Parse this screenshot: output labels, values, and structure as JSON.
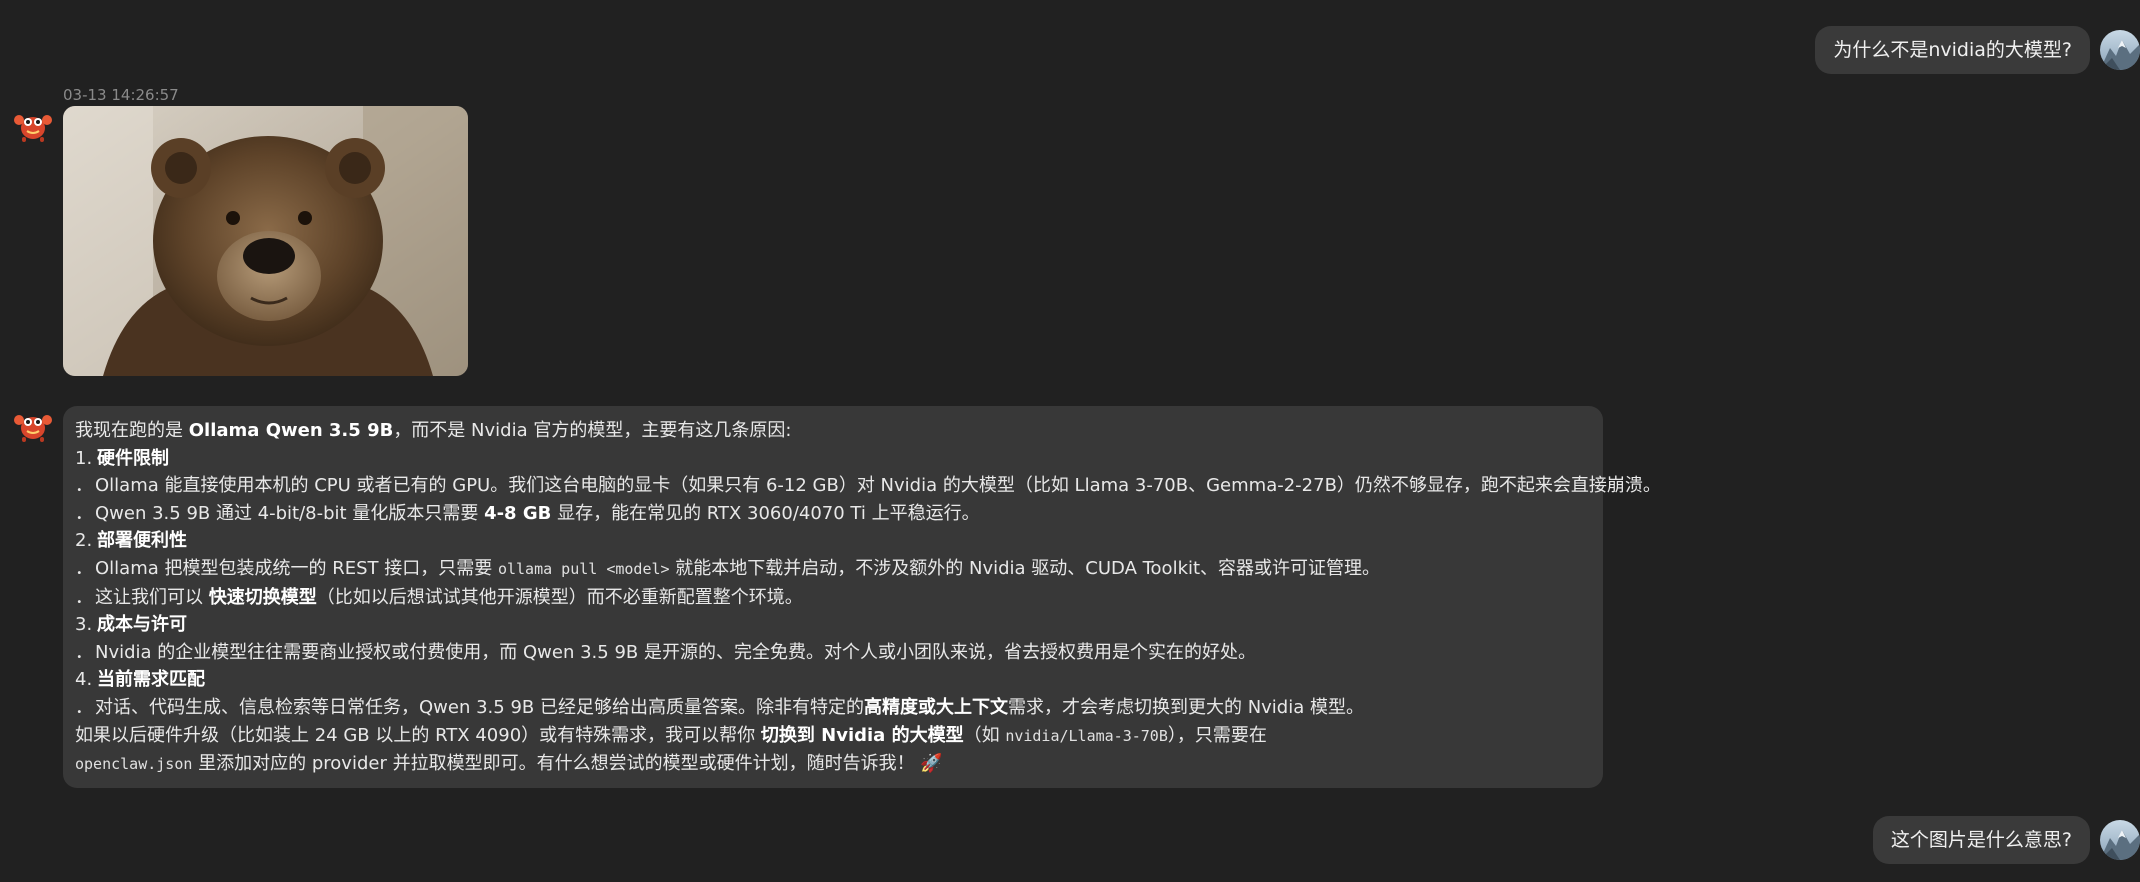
{
  "messages": {
    "user_1": "为什么不是nvidia的大模型?",
    "timestamp": "03-13 14:26:57",
    "image_alt": "brown bear",
    "answer": {
      "intro_a": "我现在跑的是 ",
      "intro_b": "Ollama Qwen 3.5 9B",
      "intro_c": "，而不是 Nvidia 官方的模型，主要有这几条原因:",
      "s1_num": "1.",
      "s1_title": "硬件限制",
      "s1_b1": "Ollama 能直接使用本机的 CPU 或者已有的 GPU。我们这台电脑的显卡（如果只有 6-12 GB）对 Nvidia 的大模型（比如 Llama 3-70B、Gemma-2-27B）仍然不够显存，跑不起来会直接崩溃。",
      "s1_b2_a": "Qwen 3.5 9B 通过 4-bit/8-bit 量化版本只需要 ",
      "s1_b2_b": "4-8 GB",
      "s1_b2_c": " 显存，能在常见的 RTX 3060/4070 Ti 上平稳运行。",
      "s2_num": "2.",
      "s2_title": "部署便利性",
      "s2_b1_a": "Ollama 把模型包装成统一的 REST 接口，只需要 ",
      "s2_b1_code": "ollama pull <model>",
      "s2_b1_c": " 就能本地下载并启动，不涉及额外的 Nvidia 驱动、CUDA Toolkit、容器或许可证管理。",
      "s2_b2_a": "这让我们可以 ",
      "s2_b2_b": "快速切换模型",
      "s2_b2_c": "（比如以后想试试其他开源模型）而不必重新配置整个环境。",
      "s3_num": "3.",
      "s3_title": "成本与许可",
      "s3_b1": "Nvidia 的企业模型往往需要商业授权或付费使用，而 Qwen 3.5 9B 是开源的、完全免费。对个人或小团队来说，省去授权费用是个实在的好处。",
      "s4_num": "4.",
      "s4_title": "当前需求匹配",
      "s4_b1_a": "对话、代码生成、信息检索等日常任务，Qwen 3.5 9B 已经足够给出高质量答案。除非有特定的",
      "s4_b1_b": "高精度或大上下文",
      "s4_b1_c": "需求，才会考虑切换到更大的 Nvidia 模型。",
      "outro1_a": "如果以后硬件升级（比如装上 24 GB 以上的 RTX 4090）或有特殊需求，我可以帮你 ",
      "outro1_b": "切换到 Nvidia 的大模型",
      "outro1_c": "（如 ",
      "outro1_code": "nvidia/Llama-3-70B",
      "outro1_d": "），只需要在",
      "outro2_code": "openclaw.json",
      "outro2_a": " 里添加对应的 provider 并拉取模型即可。有什么想尝试的模型或硬件计划，随时告诉我！",
      "outro2_emoji": "🚀"
    },
    "user_2": "这个图片是什么意思?"
  },
  "bullet": "．",
  "icons": {
    "user_avatar": "mountain-avatar-icon",
    "bot_avatar": "crab-bot-icon"
  }
}
